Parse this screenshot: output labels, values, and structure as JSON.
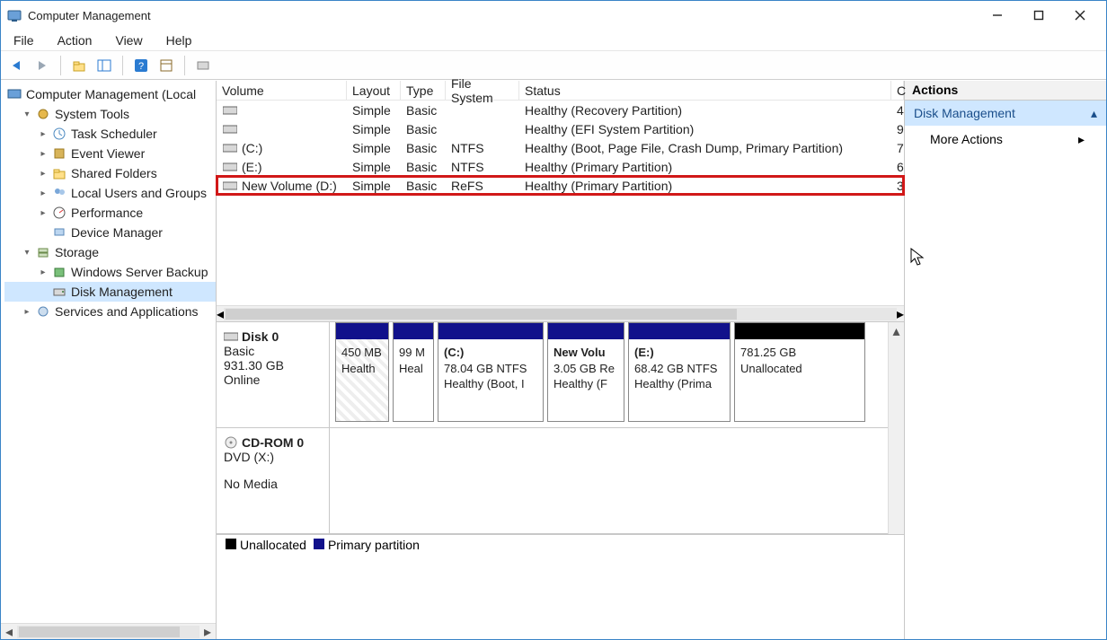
{
  "titlebar": {
    "title": "Computer Management"
  },
  "menu": {
    "file": "File",
    "action": "Action",
    "view": "View",
    "help": "Help"
  },
  "tree": {
    "root": "Computer Management (Local",
    "system_tools": "System Tools",
    "task_scheduler": "Task Scheduler",
    "event_viewer": "Event Viewer",
    "shared_folders": "Shared Folders",
    "local_users": "Local Users and Groups",
    "performance": "Performance",
    "device_manager": "Device Manager",
    "storage": "Storage",
    "wsb": "Windows Server Backup",
    "disk_mgmt": "Disk Management",
    "services": "Services and Applications"
  },
  "vol_headers": {
    "volume": "Volume",
    "layout": "Layout",
    "type": "Type",
    "fs": "File System",
    "status": "Status",
    "c": "C"
  },
  "volumes": [
    {
      "name": "",
      "layout": "Simple",
      "type": "Basic",
      "fs": "",
      "status": "Healthy (Recovery Partition)",
      "c": "4"
    },
    {
      "name": "",
      "layout": "Simple",
      "type": "Basic",
      "fs": "",
      "status": "Healthy (EFI System Partition)",
      "c": "9"
    },
    {
      "name": "(C:)",
      "layout": "Simple",
      "type": "Basic",
      "fs": "NTFS",
      "status": "Healthy (Boot, Page File, Crash Dump, Primary Partition)",
      "c": "7"
    },
    {
      "name": "(E:)",
      "layout": "Simple",
      "type": "Basic",
      "fs": "NTFS",
      "status": "Healthy (Primary Partition)",
      "c": "6"
    },
    {
      "name": "New Volume (D:)",
      "layout": "Simple",
      "type": "Basic",
      "fs": "ReFS",
      "status": "Healthy (Primary Partition)",
      "c": "3"
    }
  ],
  "disk0": {
    "name": "Disk 0",
    "type": "Basic",
    "size": "931.30 GB",
    "state": "Online",
    "parts": [
      {
        "name": "",
        "l1": "450 MB",
        "l2": "Health",
        "w": 60,
        "hatched": true
      },
      {
        "name": "",
        "l1": "99 M",
        "l2": "Heal",
        "w": 46
      },
      {
        "name": "(C:)",
        "l1": "78.04 GB NTFS",
        "l2": "Healthy (Boot, I",
        "w": 118
      },
      {
        "name": "New Volu",
        "l1": "3.05 GB Re",
        "l2": "Healthy (F",
        "w": 86
      },
      {
        "name": "(E:)",
        "l1": "68.42 GB NTFS",
        "l2": "Healthy (Prima",
        "w": 114
      },
      {
        "name": "",
        "l1": "781.25 GB",
        "l2": "Unallocated",
        "w": 146,
        "black": true
      }
    ]
  },
  "cdrom": {
    "name": "CD-ROM 0",
    "sub": "DVD (X:)",
    "state": "No Media"
  },
  "legend": {
    "unalloc": "Unallocated",
    "primary": "Primary partition"
  },
  "actions": {
    "header": "Actions",
    "section": "Disk Management",
    "more": "More Actions"
  }
}
